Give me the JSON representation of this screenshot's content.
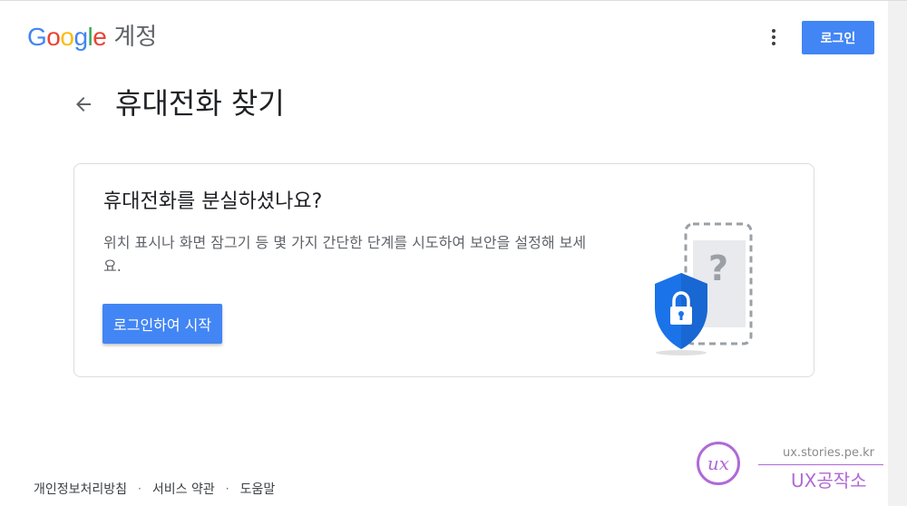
{
  "header": {
    "logo_text": "Google",
    "product_name": "계정",
    "more_icon": "more-vert-icon",
    "signin_label": "로그인"
  },
  "page": {
    "title": "휴대전화 찾기",
    "back_icon": "arrow-back-icon"
  },
  "card": {
    "heading": "휴대전화를 분실하셨나요?",
    "description": "위치 표시나 화면 잠그기 등 몇 가지 간단한 단계를 시도하여 보안을 설정해 보세요.",
    "start_label": "로그인하여 시작",
    "illustration_icon": "lost-phone-lock-icon"
  },
  "footer": {
    "links": [
      "개인정보처리방침",
      "서비스 약관",
      "도움말"
    ],
    "separator": "·"
  },
  "watermark": {
    "url": "ux.stories.pe.kr",
    "name": "UX공작소",
    "logo_text": "ux"
  },
  "colors": {
    "primary": "#4285f4",
    "text": "#202124",
    "secondary_text": "#5f6368",
    "border": "#dadce0",
    "shield": "#1a73e8",
    "watermark": "#b06ad6"
  }
}
